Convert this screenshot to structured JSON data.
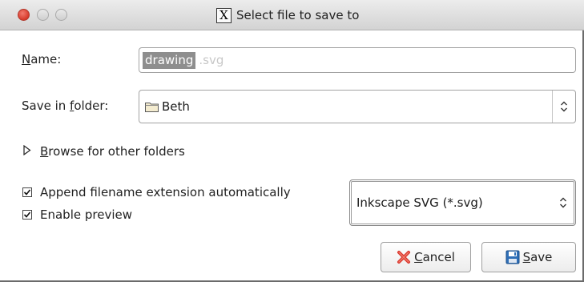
{
  "window": {
    "title": "Select file to save to",
    "app_icon": "x-window-icon"
  },
  "name_field": {
    "label_mnemonic": "N",
    "label_rest": "ame:",
    "value_selected": "drawing",
    "value_rest": ".svg"
  },
  "folder": {
    "label_before": "Save in ",
    "label_mnemonic": "f",
    "label_after": "older:",
    "value": "Beth",
    "icon": "folder-icon"
  },
  "browse": {
    "mnemonic": "B",
    "text": "rowse for other folders"
  },
  "options": {
    "append_extension": {
      "label": "Append filename extension automatically",
      "checked": true
    },
    "enable_preview": {
      "label": "Enable preview",
      "checked": true
    }
  },
  "file_type": {
    "value": "Inkscape SVG (*.svg)"
  },
  "buttons": {
    "cancel": {
      "mnemonic": "C",
      "rest": "ancel",
      "icon": "cancel-x-icon"
    },
    "save": {
      "mnemonic": "S",
      "rest": "ave",
      "icon": "floppy-disk-icon"
    }
  },
  "colors": {
    "selection_bg": "#8e8e8e",
    "close_button": "#d63a2b",
    "cancel_icon": "#d9342b",
    "save_icon": "#2f6fb7"
  }
}
